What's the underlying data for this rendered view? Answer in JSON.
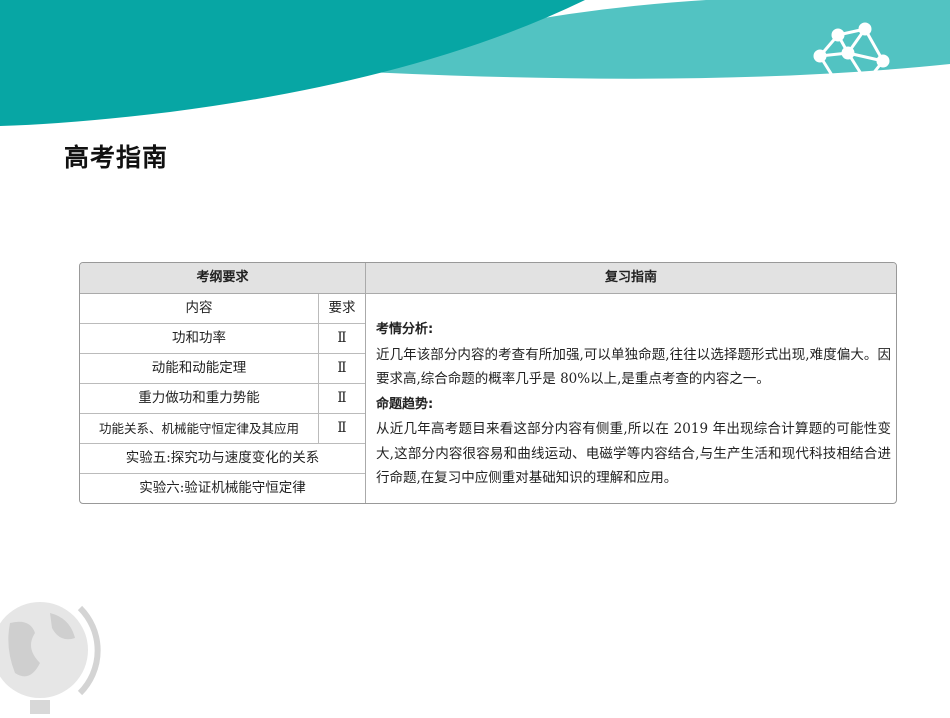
{
  "page_title": "高考指南",
  "table": {
    "left_header": "考纲要求",
    "right_header": "复习指南",
    "columns": [
      "内容",
      "要求"
    ],
    "rows": [
      {
        "content": "功和功率",
        "level": "Ⅱ"
      },
      {
        "content": "动能和动能定理",
        "level": "Ⅱ"
      },
      {
        "content": "重力做功和重力势能",
        "level": "Ⅱ"
      },
      {
        "content": "功能关系、机械能守恒定律及其应用",
        "level": "Ⅱ"
      }
    ],
    "experiments": [
      "实验五:探究功与速度变化的关系",
      "实验六:验证机械能守恒定律"
    ],
    "analysis_title": "考情分析:",
    "analysis_text": "近几年该部分内容的考查有所加强,可以单独命题,往往以选择题形式出现,难度偏大。因要求高,综合命题的概率几乎是 80%以上,是重点考查的内容之一。",
    "trend_title": "命题趋势:",
    "trend_text": "从近几年高考题目来看这部分内容有侧重,所以在 2019 年出现综合计算题的可能性变大,这部分内容很容易和曲线运动、电磁学等内容结合,与生产生活和现代科技相结合进行命题,在复习中应侧重对基础知识的理解和应用。"
  },
  "colors": {
    "dark_teal": "#07a6a4",
    "light_teal": "#52c3c2"
  }
}
